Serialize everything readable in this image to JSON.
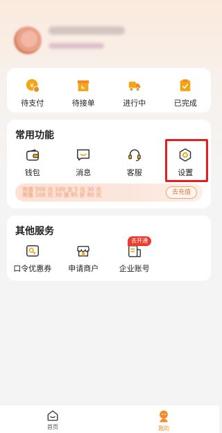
{
  "profile": {
    "name": "",
    "subtitle": ""
  },
  "orders": {
    "items": [
      {
        "label": "待支付",
        "icon": "pending-payment-icon"
      },
      {
        "label": "待接单",
        "icon": "pending-acceptance-icon"
      },
      {
        "label": "进行中",
        "icon": "in-progress-icon"
      },
      {
        "label": "已完成",
        "icon": "completed-icon"
      }
    ]
  },
  "common": {
    "title": "常用功能",
    "items": [
      {
        "label": "钱包",
        "icon": "wallet-icon"
      },
      {
        "label": "消息",
        "icon": "message-icon"
      },
      {
        "label": "客服",
        "icon": "customer-service-icon"
      },
      {
        "label": "设置",
        "icon": "settings-icon"
      }
    ],
    "banner": {
      "text_line1": "充值 500 元 100 至 5 元 30 元",
      "text_line2": "充值 100 元 30 张 85 折 80 元",
      "button": "去充值"
    }
  },
  "other": {
    "title": "其他服务",
    "badge": "去开通",
    "items": [
      {
        "label": "口令优惠券",
        "icon": "coupon-icon"
      },
      {
        "label": "申请商户",
        "icon": "merchant-icon"
      },
      {
        "label": "企业账号",
        "icon": "enterprise-account-icon"
      }
    ]
  },
  "tabbar": {
    "items": [
      {
        "label": "首页",
        "icon": "home-icon"
      },
      {
        "label": "我的",
        "icon": "mine-icon"
      }
    ],
    "active": "我的"
  },
  "colors": {
    "accent": "#f08a24",
    "highlight": "#e51f1f"
  }
}
